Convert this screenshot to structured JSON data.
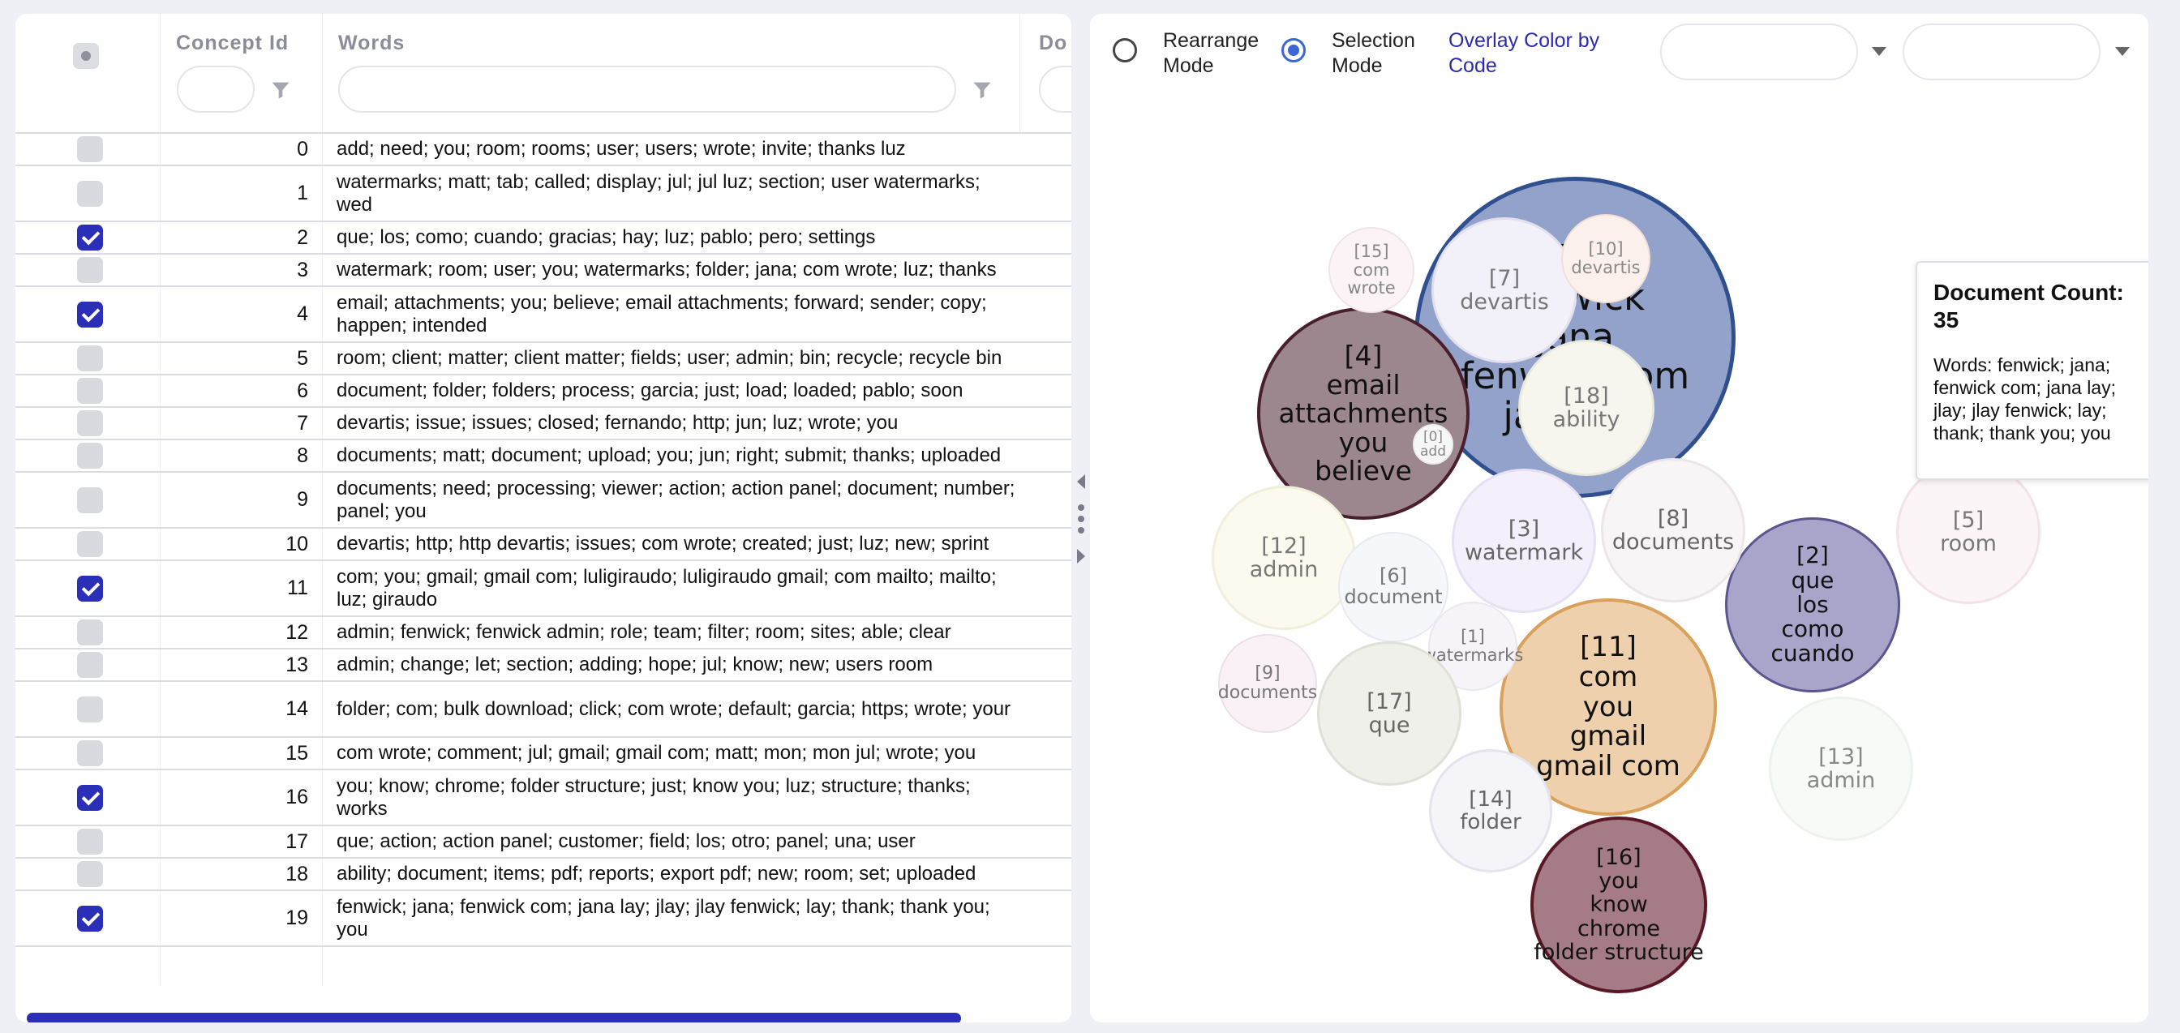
{
  "grid": {
    "columns": {
      "concept_id": "Concept Id",
      "words": "Words",
      "doc_partial": "Do"
    },
    "rows": [
      {
        "id": "0",
        "checked": false,
        "words": "add; need; you; room; rooms; user; users; wrote; invite; thanks luz"
      },
      {
        "id": "1",
        "checked": false,
        "words": "watermarks; matt; tab; called; display; jul; jul luz; section; user watermarks; wed"
      },
      {
        "id": "2",
        "checked": true,
        "words": "que; los; como; cuando; gracias; hay; luz; pablo; pero; settings"
      },
      {
        "id": "3",
        "checked": false,
        "words": "watermark; room; user; you; watermarks; folder; jana; com wrote; luz; thanks"
      },
      {
        "id": "4",
        "checked": true,
        "words": "email; attachments; you; believe; email attachments; forward; sender; copy; happen; intended"
      },
      {
        "id": "5",
        "checked": false,
        "words": "room; client; matter; client matter; fields; user; admin; bin; recycle; recycle bin"
      },
      {
        "id": "6",
        "checked": false,
        "words": "document; folder; folders; process; garcia; just; load; loaded; pablo; soon"
      },
      {
        "id": "7",
        "checked": false,
        "words": "devartis; issue; issues; closed; fernando; http; jun; luz; wrote; you"
      },
      {
        "id": "8",
        "checked": false,
        "words": "documents; matt; document; upload; you; jun; right; submit; thanks; uploaded"
      },
      {
        "id": "9",
        "checked": false,
        "words": "documents; need; processing; viewer; action; action panel; document; number; panel; you"
      },
      {
        "id": "10",
        "checked": false,
        "words": "devartis; http; http devartis; issues; com wrote; created; just; luz; new; sprint"
      },
      {
        "id": "11",
        "checked": true,
        "words": "com; you; gmail; gmail com; luligiraudo; luligiraudo gmail; com mailto; mailto; luz; giraudo"
      },
      {
        "id": "12",
        "checked": false,
        "words": "admin; fenwick; fenwick admin; role; team; filter; room; sites; able; clear"
      },
      {
        "id": "13",
        "checked": false,
        "words": "admin; change; let; section; adding; hope; jul; know; new; users room"
      },
      {
        "id": "14",
        "checked": false,
        "words": "folder; com; bulk download; click; com wrote; default; garcia; https; wrote; your"
      },
      {
        "id": "15",
        "checked": false,
        "words": "com wrote; comment; jul; gmail; gmail com; matt; mon; mon jul; wrote; you"
      },
      {
        "id": "16",
        "checked": true,
        "words": "you; know; chrome; folder structure; just; know you; luz; structure; thanks; works"
      },
      {
        "id": "17",
        "checked": false,
        "words": "que; action; action panel; customer; field; los; otro; panel; una; user"
      },
      {
        "id": "18",
        "checked": false,
        "words": "ability; document; items; pdf; reports; export pdf; new; room; set; uploaded"
      },
      {
        "id": "19",
        "checked": true,
        "words": "fenwick; jana; fenwick com; jana lay; jlay; jlay fenwick; lay; thank; thank you; you"
      }
    ]
  },
  "controls": {
    "rearrange_label": "Rearrange\nMode",
    "selection_label": "Selection\nMode",
    "overlay_label": "Overlay Color by\nCode",
    "mode": "selection"
  },
  "bubbles": [
    {
      "id": "19",
      "label": "[19]\nfenwick\njana\nfenwick com\njana lay",
      "selected": true,
      "fill": "#93a2cb",
      "stroke": "#2f4f8f",
      "color": "#111111"
    },
    {
      "id": "4",
      "label": "[4]\nemail\nattachments\nyou\nbelieve",
      "selected": true,
      "fill": "#9c878e",
      "stroke": "#4a1f2d",
      "color": "#111111"
    },
    {
      "id": "11",
      "label": "[11]\ncom\nyou\ngmail\ngmail com",
      "selected": true,
      "fill": "#eed0ad",
      "stroke": "#d9a15b",
      "color": "#111111"
    },
    {
      "id": "2",
      "label": "[2]\nque\nlos\ncomo\ncuando",
      "selected": true,
      "fill": "#a9a4c9",
      "stroke": "#5b568f",
      "color": "#111111"
    },
    {
      "id": "16",
      "label": "[16]\nyou\nknow\nchrome\nfolder structure",
      "selected": true,
      "fill": "#a57b85",
      "stroke": "#5a1826",
      "color": "#111111"
    },
    {
      "id": "7",
      "label": "[7]\ndevartis",
      "selected": false,
      "fill": "#f2f0f8",
      "stroke": "#e3e0ee",
      "color": "#777777"
    },
    {
      "id": "15",
      "label": "[15]\ncom wrote",
      "selected": false,
      "fill": "#fbf3f5",
      "stroke": "#f1e4e8",
      "color": "#888888"
    },
    {
      "id": "10",
      "label": "[10]\ndevartis",
      "selected": false,
      "fill": "#fbf0ec",
      "stroke": "#f1e0d8",
      "color": "#888888"
    },
    {
      "id": "18",
      "label": "[18]\nability",
      "selected": false,
      "fill": "#f6f6ef",
      "stroke": "#e9e9df",
      "color": "#777777"
    },
    {
      "id": "0",
      "label": "[0]\nadd",
      "selected": false,
      "fill": "#f7f7f7",
      "stroke": "#ececec",
      "color": "#888888"
    },
    {
      "id": "12",
      "label": "[12]\nadmin",
      "selected": false,
      "fill": "#fcfaee",
      "stroke": "#f2eedc",
      "color": "#777777"
    },
    {
      "id": "3",
      "label": "[3]\nwatermark",
      "selected": false,
      "fill": "#f3f0fb",
      "stroke": "#e5e0f4",
      "color": "#666666"
    },
    {
      "id": "8",
      "label": "[8]\ndocuments",
      "selected": false,
      "fill": "#f8f5f6",
      "stroke": "#ece6e8",
      "color": "#666666"
    },
    {
      "id": "5",
      "label": "[5]\nroom",
      "selected": false,
      "fill": "#fcf5f7",
      "stroke": "#f3e2e7",
      "color": "#777777"
    },
    {
      "id": "6",
      "label": "[6]\ndocument",
      "selected": false,
      "fill": "#f6f7fb",
      "stroke": "#e8eaf2",
      "color": "#777777"
    },
    {
      "id": "1",
      "label": "[1]\nwatermarks",
      "selected": false,
      "fill": "#f6f4f9",
      "stroke": "#ebe7f1",
      "color": "#777777"
    },
    {
      "id": "9",
      "label": "[9]\ndocuments",
      "selected": false,
      "fill": "#f9f1f6",
      "stroke": "#eddfe8",
      "color": "#777777"
    },
    {
      "id": "17",
      "label": "[17]\nque",
      "selected": false,
      "fill": "#f0f0ea",
      "stroke": "#e0e0d8",
      "color": "#666666"
    },
    {
      "id": "14",
      "label": "[14]\nfolder",
      "selected": false,
      "fill": "#f4f4f9",
      "stroke": "#e4e4ef",
      "color": "#666666"
    },
    {
      "id": "13",
      "label": "[13]\nadmin",
      "selected": false,
      "fill": "#f8faf8",
      "stroke": "#eef2ee",
      "color": "#888888"
    }
  ],
  "tooltip": {
    "title": "Document Count:\n35",
    "words": "Words: fenwick; jana; fenwick com; jana lay; jlay; jlay fenwick; lay; thank; thank you; you"
  }
}
